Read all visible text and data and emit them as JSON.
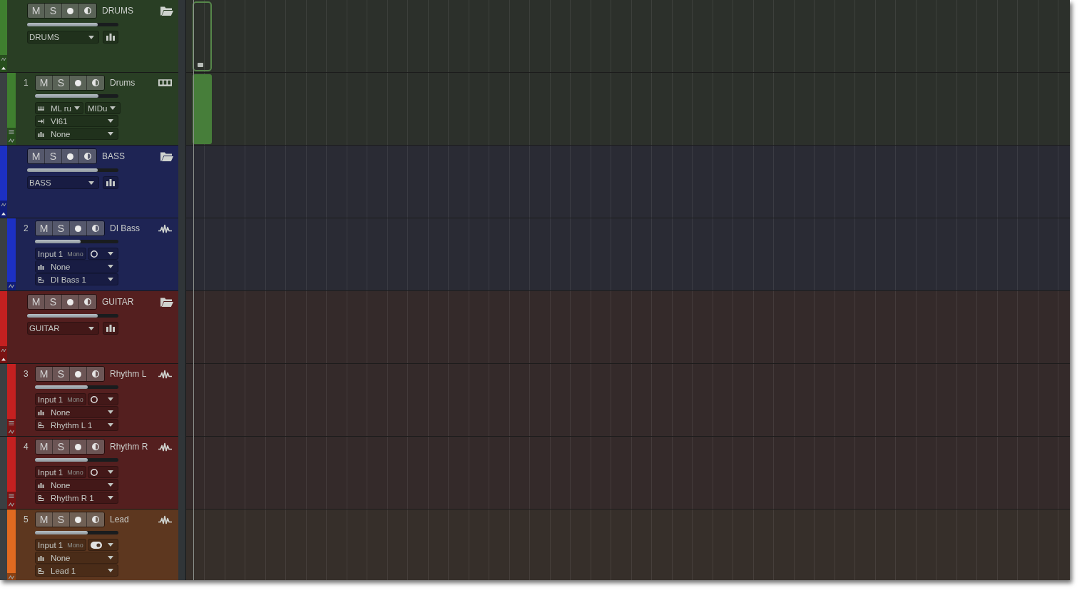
{
  "tracks": [
    {
      "kind": "folder",
      "name": "DRUMS",
      "color": "#3f7f2f",
      "mute": "M",
      "solo": "S",
      "level": 0.77,
      "bus": "DRUMS",
      "expanded": true,
      "clip": true
    },
    {
      "kind": "instrument",
      "number": "1",
      "name": "Drums",
      "color": "#3f7f2f",
      "mute": "M",
      "solo": "S",
      "level": 0.76,
      "midi_input": "ML ru",
      "midi_channel": "MIDu",
      "instrument": "VI61",
      "send": "None",
      "layers": true,
      "clip": true
    },
    {
      "kind": "folder",
      "name": "BASS",
      "color": "#1c30c4",
      "mute": "M",
      "solo": "S",
      "level": 0.77,
      "bus": "BASS",
      "expanded": true,
      "clip": false
    },
    {
      "kind": "audio",
      "number": "2",
      "name": "DI Bass",
      "color": "#1c30c4",
      "mute": "M",
      "solo": "S",
      "level": 0.55,
      "input": "Input 1",
      "input_mode": "Mono",
      "monitor": false,
      "send": "None",
      "output": "DI Bass 1",
      "layers": false,
      "clip": false
    },
    {
      "kind": "folder",
      "name": "GUITAR",
      "color": "#c42020",
      "mute": "M",
      "solo": "S",
      "level": 0.77,
      "bus": "GUITAR",
      "expanded": true,
      "clip": false
    },
    {
      "kind": "audio",
      "number": "3",
      "name": "Rhythm L",
      "color": "#c42020",
      "mute": "M",
      "solo": "S",
      "level": 0.63,
      "input": "Input 1",
      "input_mode": "Mono",
      "monitor": false,
      "send": "None",
      "output": "Rhythm L 1",
      "layers": true,
      "clip": false
    },
    {
      "kind": "audio",
      "number": "4",
      "name": "Rhythm R",
      "color": "#c42020",
      "mute": "M",
      "solo": "S",
      "level": 0.63,
      "input": "Input 1",
      "input_mode": "Mono",
      "monitor": false,
      "send": "None",
      "output": "Rhythm R 1",
      "layers": true,
      "clip": false
    },
    {
      "kind": "audio",
      "number": "5",
      "name": "Lead",
      "color": "#e06a20",
      "mute": "M",
      "solo": "S",
      "level": 0.63,
      "input": "Input 1",
      "input_mode": "Mono",
      "monitor": true,
      "send": "None",
      "output": "Lead 1",
      "layers": false,
      "clip": false
    }
  ]
}
